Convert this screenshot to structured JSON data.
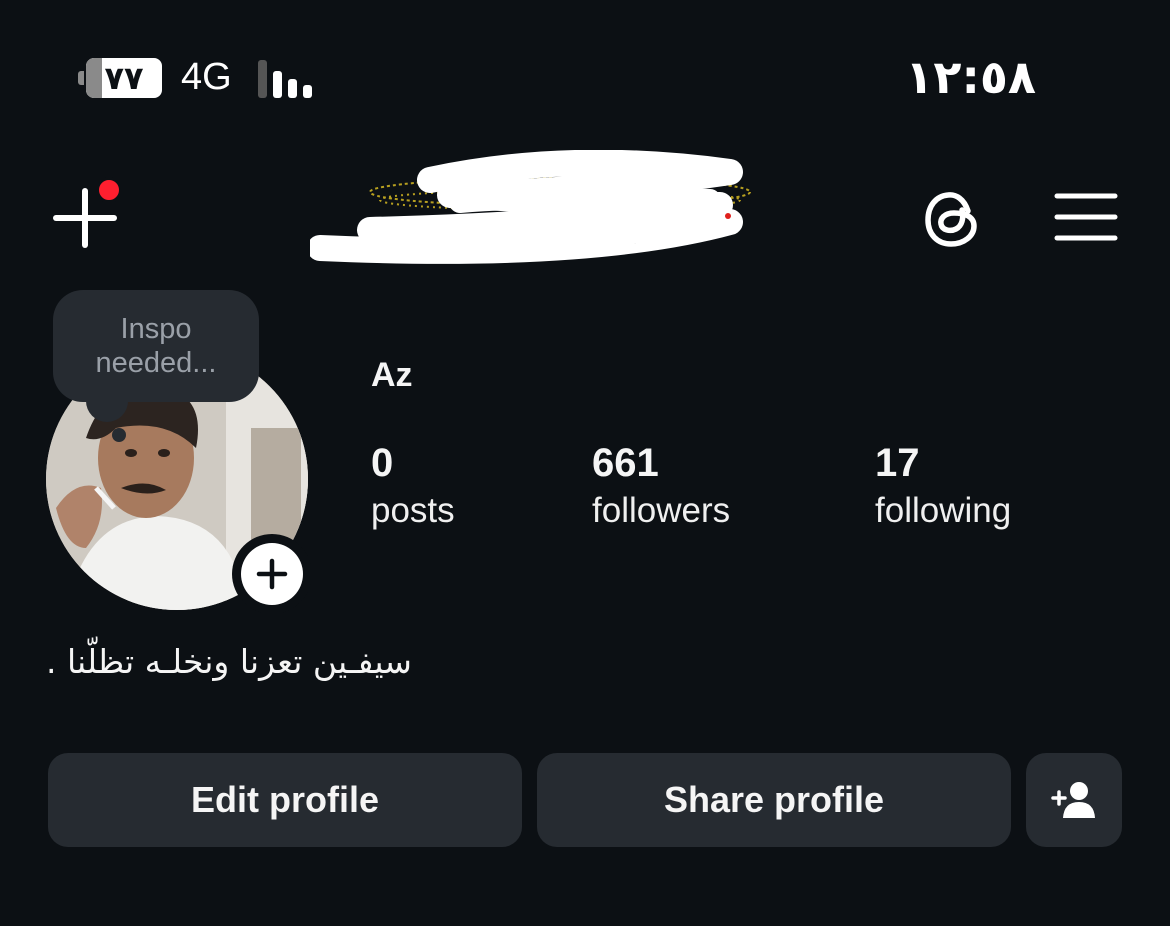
{
  "status_bar": {
    "battery_level": "٧٧",
    "network": "4G",
    "time": "١٢:٥٨"
  },
  "header": {
    "add_icon": "plus-icon",
    "notification_dot_color": "#ff1f2f",
    "threads_icon": "threads-icon",
    "menu_icon": "hamburger-menu-icon"
  },
  "profile": {
    "note_text": "Inspo needed...",
    "name": "Az",
    "stats": [
      {
        "value": "0",
        "label": "posts"
      },
      {
        "value": "661",
        "label": "followers"
      },
      {
        "value": "17",
        "label": "following"
      }
    ],
    "bio": "سيفـين تعزنا ونخلـه تظلّنا ."
  },
  "actions": {
    "edit_label": "Edit profile",
    "share_label": "Share profile",
    "discover_icon": "add-person-icon"
  },
  "colors": {
    "background": "#0c1014",
    "button_bg": "#262b31",
    "text": "#f5f5f5"
  }
}
